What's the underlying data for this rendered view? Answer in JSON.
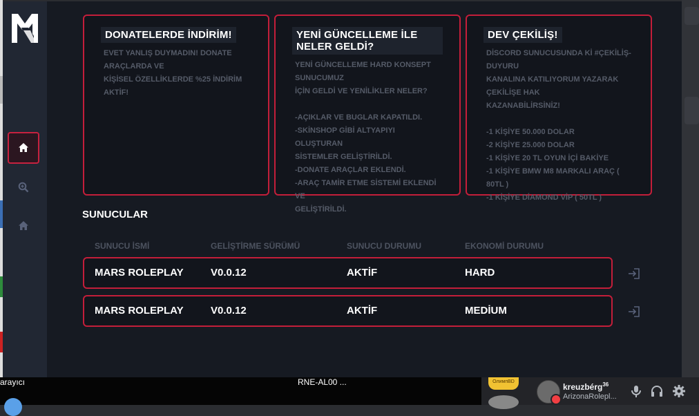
{
  "colors": {
    "accent": "#c41e3a",
    "background": "#161a22",
    "sidebar": "#212733",
    "muted_text": "#555b68"
  },
  "sidebar": {
    "logo": "mars-roleplay-logo",
    "items": [
      {
        "icon": "home-icon",
        "active": true
      },
      {
        "icon": "search-zoom-icon",
        "active": false
      },
      {
        "icon": "home-outline-icon",
        "active": false
      }
    ]
  },
  "cards": [
    {
      "title": "DONATELERDE İNDİRİM!",
      "body": "EVET YANLIŞ DUYMADIN! DONATE ARAÇLARDA VE\nKİŞİSEL ÖZELLİKLERDE %25 İNDİRİM AKTİF!"
    },
    {
      "title": "YENİ GÜNCELLEME İLE NELER GELDİ?",
      "body": "YENİ GÜNCELLEME HARD KONSEPT SUNUCUMUZ\nİÇİN GELDİ VE YENİLİKLER NELER?\n\n-AÇIKLAR VE BUGLAR KAPATILDI.\n-SKİNSHOP GİBİ ALTYAPIYI OLUŞTURAN\nSİSTEMLER GELİŞTİRİLDİ.\n-DONATE ARAÇLAR EKLENDİ.\n-ARAÇ TAMİR ETME SİSTEMİ EKLENDİ VE\nGELİŞTİRİLDİ."
    },
    {
      "title": "DEV ÇEKİLİŞ!",
      "body": "DİSCORD SUNUCUSUNDA Kİ #ÇEKİLİŞ-DUYURU\nKANALINA KATILIYORUM YAZARAK ÇEKİLİŞE HAK\nKAZANABİLİRSİNİZ!\n\n-1 KİŞİYE 50.000 DOLAR\n-2 KİŞİYE 25.000 DOLAR\n-1 KİŞİYE 20 TL OYUN İÇİ BAKİYE\n-1 KİŞİYE BMW M8 MARKALI ARAÇ ( 80TL )\n-1 KİŞİYE DİAMOND VİP ( 50TL )"
    }
  ],
  "servers": {
    "title": "SUNUCULAR",
    "columns": [
      "SUNUCU İSMİ",
      "GELİŞTİRME SÜRÜMÜ",
      "SUNUCU DURUMU",
      "EKONOMİ DURUMU"
    ],
    "rows": [
      {
        "name": "MARS ROLEPLAY",
        "version": "V0.0.12",
        "status": "AKTİF",
        "economy": "HARD",
        "action_icon": "join-icon"
      },
      {
        "name": "MARS ROLEPLAY",
        "version": "V0.0.12",
        "status": "AKTİF",
        "economy": "MEDİUM",
        "action_icon": "join-icon"
      }
    ]
  },
  "taskbar": {
    "left_text": "arayıcı",
    "center_text": "RNE-AL00 ..."
  },
  "discord": {
    "guild_label": "ОлимпBD",
    "username": "kreuzbérg",
    "username_sup": "36",
    "status_text": "ArizonaRolepl...",
    "controls": [
      "microphone-icon",
      "headphones-icon",
      "settings-gear-icon"
    ]
  }
}
